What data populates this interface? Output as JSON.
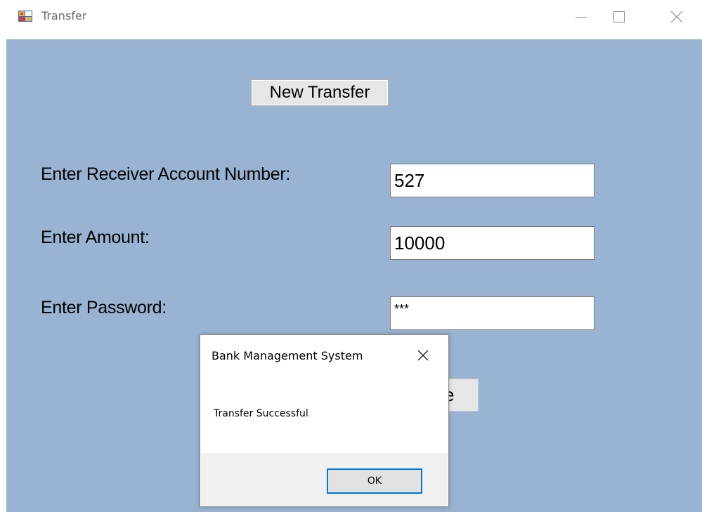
{
  "window": {
    "title": "Transfer"
  },
  "form": {
    "new_transfer_label": "New Transfer",
    "receiver_label": "Enter Receiver Account Number:",
    "receiver_value": "527",
    "amount_label": "Enter Amount:",
    "amount_value": "10000",
    "password_label": "Enter Password:",
    "password_value": "***",
    "hidden_button_fragment": "e"
  },
  "dialog": {
    "title": "Bank Management System",
    "message": "Transfer Successful",
    "ok_label": "OK"
  },
  "colors": {
    "client_background": "#98b4d2",
    "ok_focus_border": "#0078d7"
  }
}
